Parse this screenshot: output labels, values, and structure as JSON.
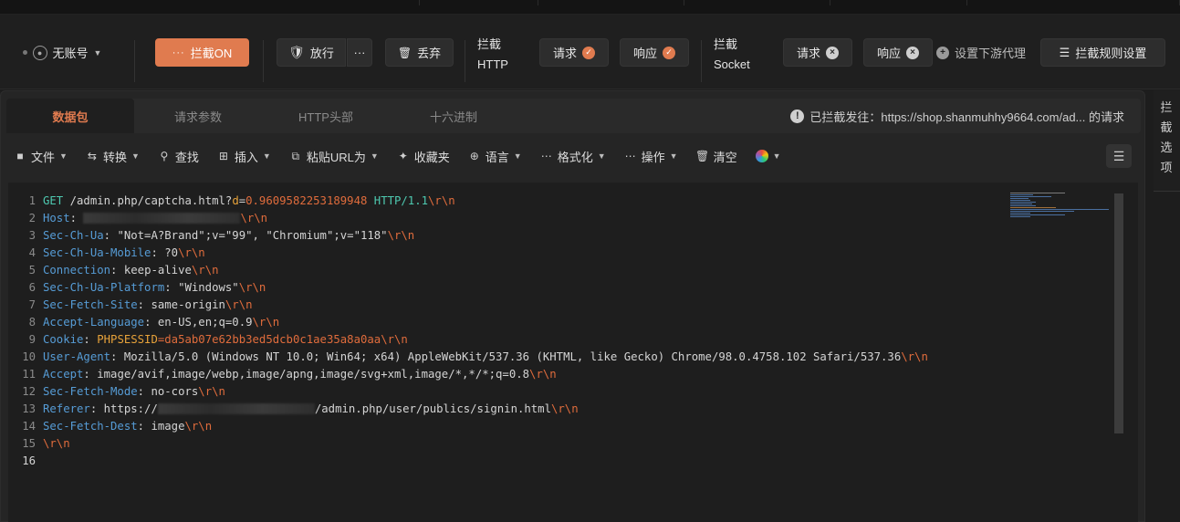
{
  "toolbar": {
    "account_label": "无账号",
    "intercept_toggle_label": "拦截ON",
    "release_label": "放行",
    "more_label": "···",
    "discard_label": "丢弃",
    "http_group": {
      "line1": "拦截",
      "line2": "HTTP"
    },
    "http_request_label": "请求",
    "http_response_label": "响应",
    "socket_group": {
      "line1": "拦截",
      "line2": "Socket"
    },
    "socket_request_label": "请求",
    "socket_response_label": "响应",
    "downstream_proxy_label": "设置下游代理",
    "rules_label": "拦截规则设置"
  },
  "tabs": [
    {
      "label": "数据包",
      "active": true
    },
    {
      "label": "请求参数",
      "active": false
    },
    {
      "label": "HTTP头部",
      "active": false
    },
    {
      "label": "十六进制",
      "active": false
    }
  ],
  "notice": "已拦截发往：https://shop.shanmuhhy9664.com/ad... 的请求",
  "ops": {
    "file": "文件",
    "convert": "转换",
    "find": "查找",
    "insert": "插入",
    "paste_url": "粘贴URL为",
    "favorites": "收藏夹",
    "language": "语言",
    "format": "格式化",
    "operation": "操作",
    "clear": "清空"
  },
  "side_panel_label": "拦截选项",
  "editor": {
    "line_numbers": [
      "1",
      "2",
      "3",
      "4",
      "5",
      "6",
      "7",
      "8",
      "9",
      "10",
      "11",
      "12",
      "13",
      "14",
      "15",
      "16"
    ],
    "l1": {
      "method": "GET",
      "path": " /admin.php/captcha.html?",
      "param": "d",
      "eq": "=",
      "pval": "0.9609582253189948",
      "proto": " HTTP/1.1",
      "crlf": "\\r\\n"
    },
    "l2": {
      "key": "Host",
      "sep": ": ",
      "crlf": "\\r\\n"
    },
    "l3": {
      "key": "Sec-Ch-Ua",
      "val": ": \"Not=A?Brand\";v=\"99\", \"Chromium\";v=\"118\"",
      "crlf": "\\r\\n"
    },
    "l4": {
      "key": "Sec-Ch-Ua-Mobile",
      "val": ": ?0",
      "crlf": "\\r\\n"
    },
    "l5": {
      "key": "Connection",
      "val": ": keep-alive",
      "crlf": "\\r\\n"
    },
    "l6": {
      "key": "Sec-Ch-Ua-Platform",
      "val": ": \"Windows\"",
      "crlf": "\\r\\n"
    },
    "l7": {
      "key": "Sec-Fetch-Site",
      "val": ": same-origin",
      "crlf": "\\r\\n"
    },
    "l8": {
      "key": "Accept-Language",
      "val": ": en-US,en;q=0.9",
      "crlf": "\\r\\n"
    },
    "l9": {
      "key": "Cookie",
      "sep": ": ",
      "ck": "PHPSESSID",
      "eq": "=",
      "cv": "da5ab07e62bb3ed5dcb0c1ae35a8a0aa",
      "crlf": "\\r\\n"
    },
    "l10": {
      "key": "User-Agent",
      "val": ": Mozilla/5.0 (Windows NT 10.0; Win64; x64) AppleWebKit/537.36 (KHTML, like Gecko) Chrome/98.0.4758.102 Safari/537.36",
      "crlf": "\\r\\n"
    },
    "l11": {
      "key": "Accept",
      "val": ": image/avif,image/webp,image/apng,image/svg+xml,image/*,*/*;q=0.8",
      "crlf": "\\r\\n"
    },
    "l12": {
      "key": "Sec-Fetch-Mode",
      "val": ": no-cors",
      "crlf": "\\r\\n"
    },
    "l13": {
      "key": "Referer",
      "val1": ": https://",
      "val2": "/admin.php/user/publics/signin.html",
      "crlf": "\\r\\n"
    },
    "l14": {
      "key": "Sec-Fetch-Dest",
      "val": ": image",
      "crlf": "\\r\\n"
    },
    "l15": {
      "crlf": "\\r\\n"
    }
  },
  "icons": {
    "account": "user-icon",
    "release": "shield-icon",
    "discard": "trash-icon",
    "rules": "sliders-icon",
    "info": "info-icon",
    "settings": "sliders-icon"
  },
  "colors": {
    "accent": "#e07b4f",
    "key": "#569cd6",
    "crlf": "#e06c3c"
  }
}
